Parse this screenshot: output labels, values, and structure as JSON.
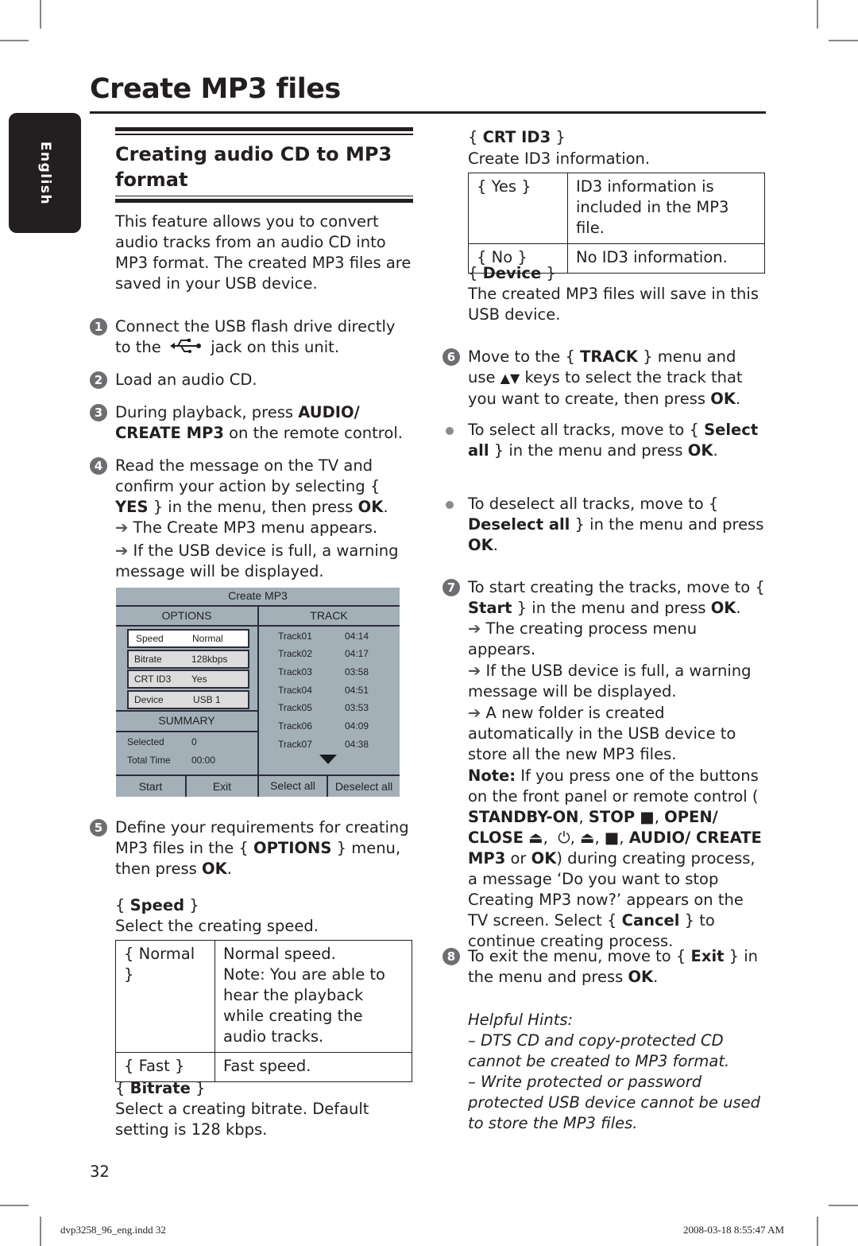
{
  "page": {
    "title": "Create MP3 files",
    "language_tab": "English",
    "page_number": "32",
    "footer_left": "dvp3258_96_eng.indd   32",
    "footer_right": "2008-03-18   8:55:47 AM"
  },
  "section": {
    "heading": "Creating audio CD to MP3 format",
    "intro": "This feature allows you to convert audio tracks from an audio CD into MP3 format. The created MP3 files are saved in your USB device."
  },
  "steps": [
    {
      "num": "1",
      "pre": "Connect the USB flash drive directly to the",
      "icon": "usb-icon",
      "post": "jack on this unit."
    },
    {
      "num": "2",
      "text": "Load an audio CD."
    },
    {
      "num": "3",
      "pre": "During playback, press ",
      "bold": "AUDIO/ CREATE MP3",
      "post": " on the remote control."
    },
    {
      "num": "4",
      "pre": "Read the message on the TV and confirm your action by selecting { ",
      "bold1": "YES",
      "mid": " } in the menu, then press ",
      "bold2": "OK",
      "end": ".",
      "results": [
        "The Create MP3 menu appears.",
        "If the USB device is full, a warning message will be displayed."
      ]
    },
    {
      "num": "5",
      "pre": "Define your requirements for creating MP3 files in the { ",
      "bold1": "OPTIONS",
      "mid": " } menu, then press ",
      "bold2": "OK",
      "end": "."
    },
    {
      "num": "6",
      "pre": "Move to the { ",
      "bold1": "TRACK",
      "mid": " } menu and use ",
      "keys": "▲▼",
      "post": " keys to select the track that you want to create, then press ",
      "bold2": "OK",
      "end": "."
    },
    {
      "num": "7",
      "pre": "To start creating the tracks, move to { ",
      "bold1": "Start",
      "mid": " } in the menu and press ",
      "bold2": "OK",
      "end": ".",
      "results": [
        "The creating process menu appears.",
        "If the USB device is full, a warning message will be displayed.",
        "A new folder is created automatically in the USB device to store all the new MP3 files."
      ]
    },
    {
      "num": "8",
      "pre": "To exit the menu, move to { ",
      "bold1": "Exit",
      "mid": " } in the menu and press ",
      "bold2": "OK",
      "end": "."
    }
  ],
  "bullets": [
    {
      "pre": "To select all tracks, move to { ",
      "bold1": "Select all",
      "mid": " } in the menu and press ",
      "bold2": "OK",
      "end": "."
    },
    {
      "pre": "To deselect all tracks, move to { ",
      "bold1": "Deselect all",
      "mid": " } in the menu and press ",
      "bold2": "OK",
      "end": "."
    }
  ],
  "menu": {
    "title": "Create MP3",
    "options_header": "OPTIONS",
    "track_header": "TRACK",
    "summary_header": "SUMMARY",
    "options": [
      {
        "label": "Speed",
        "value": "Normal",
        "selected": true
      },
      {
        "label": "Bitrate",
        "value": "128kbps"
      },
      {
        "label": "CRT ID3",
        "value": "Yes"
      },
      {
        "label": "Device",
        "value": "USB 1"
      }
    ],
    "summary": [
      {
        "label": "Selected",
        "value": "0"
      },
      {
        "label": "Total Time",
        "value": "00:00"
      }
    ],
    "tracks": [
      {
        "name": "Track01",
        "time": "04:14"
      },
      {
        "name": "Track02",
        "time": "04:17"
      },
      {
        "name": "Track03",
        "time": "03:58"
      },
      {
        "name": "Track04",
        "time": "04:51"
      },
      {
        "name": "Track05",
        "time": "03:53"
      },
      {
        "name": "Track06",
        "time": "04:09"
      },
      {
        "name": "Track07",
        "time": "04:38"
      }
    ],
    "buttons": [
      "Start",
      "Exit",
      "Select all",
      "Deselect all"
    ]
  },
  "speed": {
    "heading": "Speed",
    "desc": "Select the creating speed.",
    "rows": [
      {
        "option": "{ Normal }",
        "lines": [
          "Normal speed.",
          "Note:  You are able to hear the playback while creating the audio tracks."
        ]
      },
      {
        "option": "{ Fast }",
        "lines": [
          "Fast speed."
        ]
      }
    ]
  },
  "bitrate": {
    "heading": "Bitrate",
    "desc": "Select a creating bitrate.  Default setting is 128 kbps."
  },
  "crtid3": {
    "heading": "CRT ID3",
    "desc": "Create ID3 information.",
    "rows": [
      {
        "option": "{ Yes }",
        "desc": "ID3 information is included in the MP3 file."
      },
      {
        "option": "{ No }",
        "desc": "No ID3 information."
      }
    ]
  },
  "device": {
    "heading": "Device",
    "desc": "The created MP3 files will save in this USB device."
  },
  "note": {
    "label": "Note:",
    "text1": " If you press one of the buttons on the front panel or remote control ( ",
    "b1": "STANDBY-ON",
    "b2": "STOP",
    "b3": "OPEN/ CLOSE",
    "b4": "AUDIO/ CREATE MP3",
    "or": " or ",
    "b5": "OK",
    "text2": ") during creating process, a message ‘Do you want to stop Creating MP3 now?’ appears on the TV screen. Select { ",
    "b6": "Cancel",
    "text3": " } to continue creating process."
  },
  "hints": {
    "title": "Helpful Hints:",
    "items": [
      "–  DTS CD and copy-protected CD cannot be created to MP3 format.",
      "–  Write protected or password protected USB device cannot be used to store the MP3 files."
    ]
  }
}
